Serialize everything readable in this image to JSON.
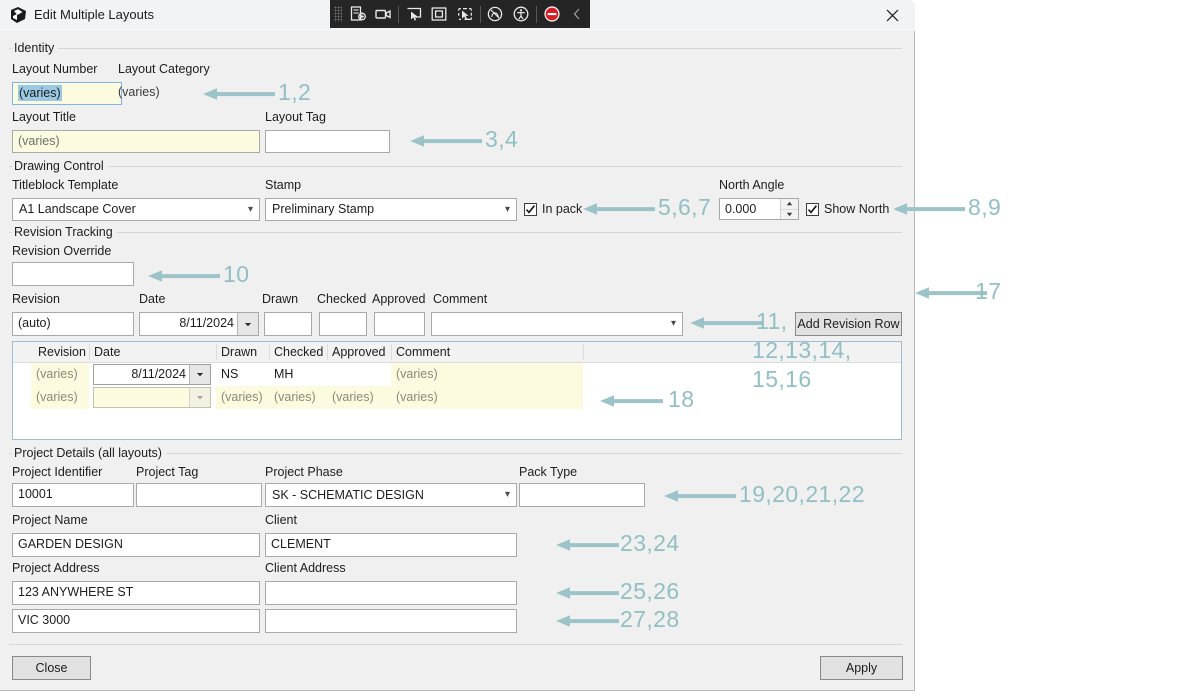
{
  "window": {
    "title": "Edit Multiple Layouts",
    "icon": "app-icon",
    "close_label": "✕",
    "capture_toolbar": {
      "icons": [
        "capture-region-icon",
        "record-video-icon",
        "capture-window-icon",
        "capture-fullscreen-icon",
        "capture-scrolling-icon",
        "annotate-icon",
        "accessibility-icon",
        "stop-icon",
        "collapse-icon"
      ]
    }
  },
  "identity": {
    "group_title": "Identity",
    "layout_number_label": "Layout Number",
    "layout_number_value": "(varies)",
    "layout_category_label": "Layout Category",
    "layout_category_value": "(varies)",
    "layout_title_label": "Layout Title",
    "layout_title_value": "(varies)",
    "layout_tag_label": "Layout Tag",
    "layout_tag_value": ""
  },
  "drawing_control": {
    "group_title": "Drawing Control",
    "titleblock_label": "Titleblock Template",
    "titleblock_value": "A1 Landscape Cover",
    "stamp_label": "Stamp",
    "stamp_value": "Preliminary Stamp",
    "in_pack_label": "In pack",
    "in_pack_checked": true,
    "north_angle_label": "North Angle",
    "north_angle_value": "0.000",
    "show_north_label": "Show North",
    "show_north_checked": true
  },
  "revision_tracking": {
    "group_title": "Revision Tracking",
    "revision_override_label": "Revision Override",
    "revision_override_value": "",
    "revision_label": "Revision",
    "revision_value": "(auto)",
    "date_label": "Date",
    "date_value": "8/11/2024",
    "drawn_label": "Drawn",
    "drawn_value": "",
    "checked_label": "Checked",
    "checked_value": "",
    "approved_label": "Approved",
    "approved_value": "",
    "comment_label": "Comment",
    "comment_value": "",
    "add_revision_row_label": "Add Revision Row",
    "grid": {
      "columns": [
        "Revision",
        "Date",
        "Drawn",
        "Checked",
        "Approved",
        "Comment"
      ],
      "rows": [
        {
          "revision": "(varies)",
          "date": "8/11/2024",
          "drawn": "NS",
          "checked": "MH",
          "approved": "",
          "comment": "(varies)"
        },
        {
          "revision": "(varies)",
          "date": "",
          "drawn": "(varies)",
          "checked": "(varies)",
          "approved": "(varies)",
          "comment": "(varies)"
        }
      ]
    }
  },
  "project_details": {
    "group_title": "Project Details (all layouts)",
    "project_identifier_label": "Project Identifier",
    "project_identifier_value": "10001",
    "project_tag_label": "Project Tag",
    "project_tag_value": "",
    "project_phase_label": "Project Phase",
    "project_phase_value": "SK - SCHEMATIC DESIGN",
    "pack_type_label": "Pack Type",
    "pack_type_value": "",
    "project_name_label": "Project Name",
    "project_name_value": "GARDEN DESIGN",
    "client_label": "Client",
    "client_value": "CLEMENT",
    "project_address_label": "Project Address",
    "project_address_value": "123 ANYWHERE ST",
    "project_address_value2": "VIC 3000",
    "client_address_label": "Client Address",
    "client_address_value": "",
    "client_address_value2": ""
  },
  "footer": {
    "close_label": "Close",
    "apply_label": "Apply"
  },
  "annotations": {
    "color": "#91bfc4",
    "items": [
      {
        "id": "a1",
        "text": "1,2"
      },
      {
        "id": "a2",
        "text": "3,4"
      },
      {
        "id": "a3",
        "text": "5,6,7"
      },
      {
        "id": "a4",
        "text": "8,9"
      },
      {
        "id": "a5",
        "text": "10"
      },
      {
        "id": "a6",
        "text": "11,"
      },
      {
        "id": "a7",
        "text": "12,13,14,"
      },
      {
        "id": "a8",
        "text": "15,16"
      },
      {
        "id": "a9",
        "text": "17"
      },
      {
        "id": "a10",
        "text": "18"
      },
      {
        "id": "a11",
        "text": "19,20,21,22"
      },
      {
        "id": "a12",
        "text": "23,24"
      },
      {
        "id": "a13",
        "text": "25,26"
      },
      {
        "id": "a14",
        "text": "27,28"
      }
    ]
  }
}
